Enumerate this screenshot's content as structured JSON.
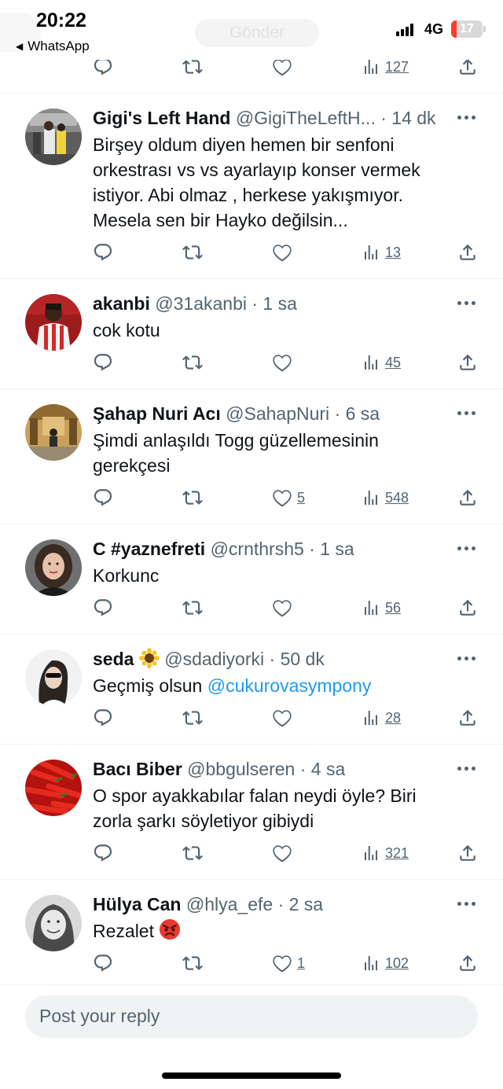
{
  "status_bar": {
    "time": "20:22",
    "back_app": "WhatsApp",
    "ghost_button": "Gönder",
    "network": "4G",
    "battery": "17",
    "battery_level": 0.17
  },
  "top_actions": {
    "views": "127"
  },
  "tweets": [
    {
      "name": "Gigi's Left Hand",
      "handle": "@GigiTheLeftH...",
      "time": "· 14 dk",
      "lines": [
        "Birşey oldum diyen hemen bir senfoni",
        "orkestrası vs vs ayarlayıp konser vermek",
        "istiyor. Abi olmaz , herkese yakışmıyor.",
        "Mesela sen bir Hayko değilsin..."
      ],
      "likes": "",
      "views": "13",
      "avatar_icon": "basketball-photo-avatar"
    },
    {
      "name": "akanbi",
      "handle": "@31akanbi",
      "time": "· 1 sa",
      "lines": [
        "cok kotu"
      ],
      "likes": "",
      "views": "45",
      "avatar_icon": "footballer-avatar"
    },
    {
      "name": "Şahap Nuri Acı",
      "handle": "@SahapNuri",
      "time": "· 6 sa",
      "lines": [
        "Şimdi anlaşıldı Togg güzellemesinin",
        "gerekçesi"
      ],
      "likes": "5",
      "views": "548",
      "avatar_icon": "temple-photo-avatar"
    },
    {
      "name": "C #yaznefreti",
      "handle": "@crnthrsh5",
      "time": "· 1 sa",
      "lines": [
        "Korkunc"
      ],
      "likes": "",
      "views": "56",
      "avatar_icon": "woman-portrait-avatar"
    },
    {
      "name": "seda",
      "handle": "@sdadiyorki",
      "time": "· 50 dk",
      "text_prefix": "Geçmiş olsun ",
      "mention": "@cukurovasympony",
      "likes": "",
      "views": "28",
      "name_emoji": "sunflower-emoji",
      "avatar_icon": "woman-sunglasses-avatar"
    },
    {
      "name": "Bacı Biber",
      "handle": "@bbgulseren",
      "time": "· 4 sa",
      "lines": [
        "O spor ayakkabılar falan neydi öyle? Biri",
        "zorla şarkı söyletiyor gibiydi"
      ],
      "likes": "",
      "views": "321",
      "avatar_icon": "red-peppers-avatar"
    },
    {
      "name": "Hülya Can",
      "handle": "@hlya_efe",
      "time": "· 2 sa",
      "text_prefix": "Rezalet ",
      "likes": "1",
      "views": "102",
      "text_emoji": "angry-face-emoji",
      "avatar_icon": "smiling-woman-avatar"
    }
  ],
  "composer": {
    "placeholder": "Post your reply"
  },
  "colors": {
    "text": "#0f1419",
    "muted": "#536471",
    "link": "#1d9bf0",
    "divider": "#eff3f4",
    "battery_low": "#ff3b30"
  }
}
